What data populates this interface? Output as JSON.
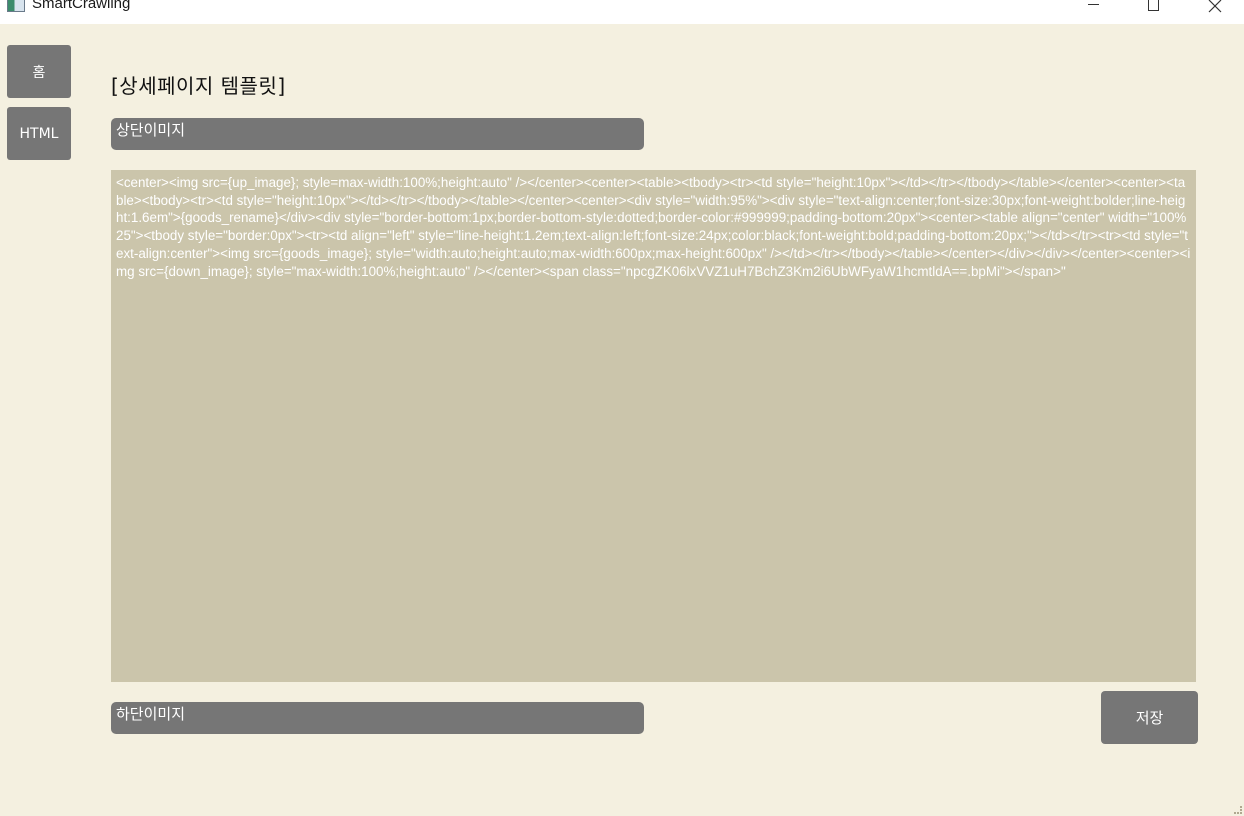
{
  "window": {
    "title": "SmartCrawling",
    "icon": "app-window-icon",
    "controls": {
      "minimize": "minimize-icon",
      "maximize": "maximize-icon",
      "close": "close-icon"
    }
  },
  "sidebar": {
    "items": [
      {
        "label": "홈"
      },
      {
        "label": "HTML"
      }
    ]
  },
  "main": {
    "title": "[상세페이지 템플릿]",
    "top_image_field": {
      "value": "상단이미지"
    },
    "template_editor": {
      "value": "<center><img src={up_image}; style=max-width:100%;height:auto\" /></center><center><table><tbody><tr><td style=\"height:10px\"></td></tr></tbody></table></center><center><table><tbody><tr><td style=\"height:10px\"></td></tr></tbody></table></center><center><div style=\"width:95%\"><div style=\"text-align:center;font-size:30px;font-weight:bolder;line-height:1.6em\">{goods_rename}</div><div style=\"border-bottom:1px;border-bottom-style:dotted;border-color:#999999;padding-bottom:20px\"><center><table align=\"center\" width=\"100%25\"><tbody style=\"border:0px\"><tr><td align=\"left\" style=\"line-height:1.2em;text-align:left;font-size:24px;color:black;font-weight:bold;padding-bottom:20px;\"></td></tr><tr><td style=\"text-align:center\"><img src={goods_image}; style=\"width:auto;height:auto;max-width:600px;max-height:600px\" /></td></tr></tbody></table></center></div></div></center><center><img src={down_image}; style=\"max-width:100%;height:auto\" /></center><span class=\"npcgZK06lxVVZ1uH7BchZ3Km2i6UbWFyaW1hcmtldA==.bpMi\"></span>\""
    },
    "bottom_image_field": {
      "value": "하단이미지"
    },
    "save_button": {
      "label": "저장"
    }
  },
  "colors": {
    "background": "#f4f0e0",
    "button": "#767676",
    "editor_background": "#cbc5ab",
    "text_light": "#ffffff"
  }
}
